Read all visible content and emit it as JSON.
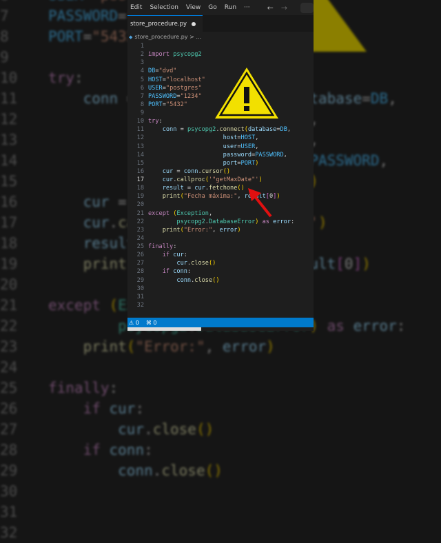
{
  "menu": {
    "items": [
      "Edit",
      "Selection",
      "View",
      "Go",
      "Run",
      "···"
    ]
  },
  "tab": {
    "filename": "store_procedure.py"
  },
  "breadcrumb": {
    "file": "store_procedure.py",
    "sep": "> …"
  },
  "status": {
    "warnings": "⚠ 0",
    "ports": "⌘ 0"
  },
  "active_line": 17,
  "editor": {
    "lines": [
      {
        "tokens": []
      },
      {
        "tokens": [
          {
            "t": "import ",
            "c": "kw"
          },
          {
            "t": "psycopg2",
            "c": "mod"
          }
        ]
      },
      {
        "tokens": []
      },
      {
        "tokens": [
          {
            "t": "DB",
            "c": "const"
          },
          {
            "t": "=",
            "c": "op"
          },
          {
            "t": "\"dvd\"",
            "c": "str"
          }
        ]
      },
      {
        "tokens": [
          {
            "t": "HOST",
            "c": "const"
          },
          {
            "t": "=",
            "c": "op"
          },
          {
            "t": "\"localhost\"",
            "c": "str"
          }
        ]
      },
      {
        "tokens": [
          {
            "t": "USER",
            "c": "const"
          },
          {
            "t": "=",
            "c": "op"
          },
          {
            "t": "\"postgres\"",
            "c": "str"
          }
        ]
      },
      {
        "tokens": [
          {
            "t": "PASSWORD",
            "c": "const"
          },
          {
            "t": "=",
            "c": "op"
          },
          {
            "t": "\"1234\"",
            "c": "str"
          }
        ]
      },
      {
        "tokens": [
          {
            "t": "PORT",
            "c": "const"
          },
          {
            "t": "=",
            "c": "op"
          },
          {
            "t": "\"5432\"",
            "c": "str"
          }
        ]
      },
      {
        "tokens": []
      },
      {
        "tokens": [
          {
            "t": "try",
            "c": "kw"
          },
          {
            "t": ":",
            "c": "op"
          }
        ]
      },
      {
        "tokens": [
          {
            "t": "    conn",
            "c": "var"
          },
          {
            "t": " = ",
            "c": "op"
          },
          {
            "t": "psycopg2",
            "c": "mod"
          },
          {
            "t": ".",
            "c": "op"
          },
          {
            "t": "connect",
            "c": "fn"
          },
          {
            "t": "(",
            "c": "br"
          },
          {
            "t": "database",
            "c": "var"
          },
          {
            "t": "=",
            "c": "op"
          },
          {
            "t": "DB",
            "c": "const"
          },
          {
            "t": ",",
            "c": "op"
          }
        ]
      },
      {
        "tokens": [
          {
            "t": "                     host",
            "c": "var"
          },
          {
            "t": "=",
            "c": "op"
          },
          {
            "t": "HOST",
            "c": "const"
          },
          {
            "t": ",",
            "c": "op"
          }
        ]
      },
      {
        "tokens": [
          {
            "t": "                     user",
            "c": "var"
          },
          {
            "t": "=",
            "c": "op"
          },
          {
            "t": "USER",
            "c": "const"
          },
          {
            "t": ",",
            "c": "op"
          }
        ]
      },
      {
        "tokens": [
          {
            "t": "                     password",
            "c": "var"
          },
          {
            "t": "=",
            "c": "op"
          },
          {
            "t": "PASSWORD",
            "c": "const"
          },
          {
            "t": ",",
            "c": "op"
          }
        ]
      },
      {
        "tokens": [
          {
            "t": "                     port",
            "c": "var"
          },
          {
            "t": "=",
            "c": "op"
          },
          {
            "t": "PORT",
            "c": "const"
          },
          {
            "t": ")",
            "c": "br"
          }
        ]
      },
      {
        "tokens": [
          {
            "t": "    cur",
            "c": "var"
          },
          {
            "t": " = ",
            "c": "op"
          },
          {
            "t": "conn",
            "c": "var"
          },
          {
            "t": ".",
            "c": "op"
          },
          {
            "t": "cursor",
            "c": "fn"
          },
          {
            "t": "()",
            "c": "br"
          }
        ]
      },
      {
        "tokens": [
          {
            "t": "    cur",
            "c": "var"
          },
          {
            "t": ".",
            "c": "op"
          },
          {
            "t": "callproc",
            "c": "fn"
          },
          {
            "t": "(",
            "c": "br"
          },
          {
            "t": "'\"getMaxDate\"'",
            "c": "str"
          },
          {
            "t": ")",
            "c": "br"
          }
        ]
      },
      {
        "tokens": [
          {
            "t": "    result",
            "c": "var"
          },
          {
            "t": " = ",
            "c": "op"
          },
          {
            "t": "cur",
            "c": "var"
          },
          {
            "t": ".",
            "c": "op"
          },
          {
            "t": "fetchone",
            "c": "fn"
          },
          {
            "t": "()",
            "c": "br"
          }
        ]
      },
      {
        "tokens": [
          {
            "t": "    print",
            "c": "fn"
          },
          {
            "t": "(",
            "c": "br"
          },
          {
            "t": "\"Fecha máxima:\"",
            "c": "str"
          },
          {
            "t": ", ",
            "c": "op"
          },
          {
            "t": "result",
            "c": "var"
          },
          {
            "t": "[",
            "c": "br2"
          },
          {
            "t": "0",
            "c": "op"
          },
          {
            "t": "]",
            "c": "br2"
          },
          {
            "t": ")",
            "c": "br"
          }
        ]
      },
      {
        "tokens": []
      },
      {
        "tokens": [
          {
            "t": "except ",
            "c": "kw"
          },
          {
            "t": "(",
            "c": "br"
          },
          {
            "t": "Exception",
            "c": "mod"
          },
          {
            "t": ",",
            "c": "op"
          }
        ]
      },
      {
        "tokens": [
          {
            "t": "        psycopg2",
            "c": "mod"
          },
          {
            "t": ".",
            "c": "op"
          },
          {
            "t": "DatabaseError",
            "c": "mod"
          },
          {
            "t": ")",
            "c": "br"
          },
          {
            "t": " as ",
            "c": "kw"
          },
          {
            "t": "error",
            "c": "var"
          },
          {
            "t": ":",
            "c": "op"
          }
        ]
      },
      {
        "tokens": [
          {
            "t": "    print",
            "c": "fn"
          },
          {
            "t": "(",
            "c": "br"
          },
          {
            "t": "\"Error:\"",
            "c": "str"
          },
          {
            "t": ", ",
            "c": "op"
          },
          {
            "t": "error",
            "c": "var"
          },
          {
            "t": ")",
            "c": "br"
          }
        ]
      },
      {
        "tokens": []
      },
      {
        "tokens": [
          {
            "t": "finally",
            "c": "kw"
          },
          {
            "t": ":",
            "c": "op"
          }
        ]
      },
      {
        "tokens": [
          {
            "t": "    if ",
            "c": "kw"
          },
          {
            "t": "cur",
            "c": "var"
          },
          {
            "t": ":",
            "c": "op"
          }
        ]
      },
      {
        "tokens": [
          {
            "t": "        cur",
            "c": "var"
          },
          {
            "t": ".",
            "c": "op"
          },
          {
            "t": "close",
            "c": "fn"
          },
          {
            "t": "()",
            "c": "br"
          }
        ]
      },
      {
        "tokens": [
          {
            "t": "    if ",
            "c": "kw"
          },
          {
            "t": "conn",
            "c": "var"
          },
          {
            "t": ":",
            "c": "op"
          }
        ]
      },
      {
        "tokens": [
          {
            "t": "        conn",
            "c": "var"
          },
          {
            "t": ".",
            "c": "op"
          },
          {
            "t": "close",
            "c": "fn"
          },
          {
            "t": "()",
            "c": "br"
          }
        ]
      },
      {
        "tokens": []
      },
      {
        "tokens": []
      },
      {
        "tokens": []
      }
    ]
  }
}
